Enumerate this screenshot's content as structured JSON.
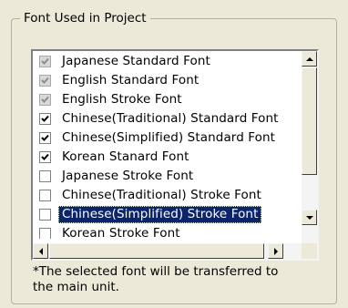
{
  "group": {
    "title": "Font Used in Project"
  },
  "font_list": {
    "items": [
      {
        "label": "Japanese Standard Font",
        "checked": true,
        "enabled": false,
        "selected": false
      },
      {
        "label": "English Standard Font",
        "checked": true,
        "enabled": false,
        "selected": false
      },
      {
        "label": "English Stroke Font",
        "checked": true,
        "enabled": false,
        "selected": false
      },
      {
        "label": "Chinese(Traditional) Standard Font",
        "checked": true,
        "enabled": true,
        "selected": false
      },
      {
        "label": "Chinese(Simplified) Standard Font",
        "checked": true,
        "enabled": true,
        "selected": false
      },
      {
        "label": "Korean Stanard Font",
        "checked": true,
        "enabled": true,
        "selected": false
      },
      {
        "label": "Japanese Stroke Font",
        "checked": false,
        "enabled": true,
        "selected": false
      },
      {
        "label": "Chinese(Traditional) Stroke Font",
        "checked": false,
        "enabled": true,
        "selected": false
      },
      {
        "label": "Chinese(Simplified) Stroke Font",
        "checked": false,
        "enabled": true,
        "selected": true
      },
      {
        "label": "Korean Stroke Font",
        "checked": false,
        "enabled": true,
        "selected": false
      }
    ]
  },
  "note": {
    "line1": "*The selected font will be transferred to",
    "line2": "the main unit."
  },
  "colors": {
    "selection": "#0b2470",
    "face": "#ece9d8"
  }
}
